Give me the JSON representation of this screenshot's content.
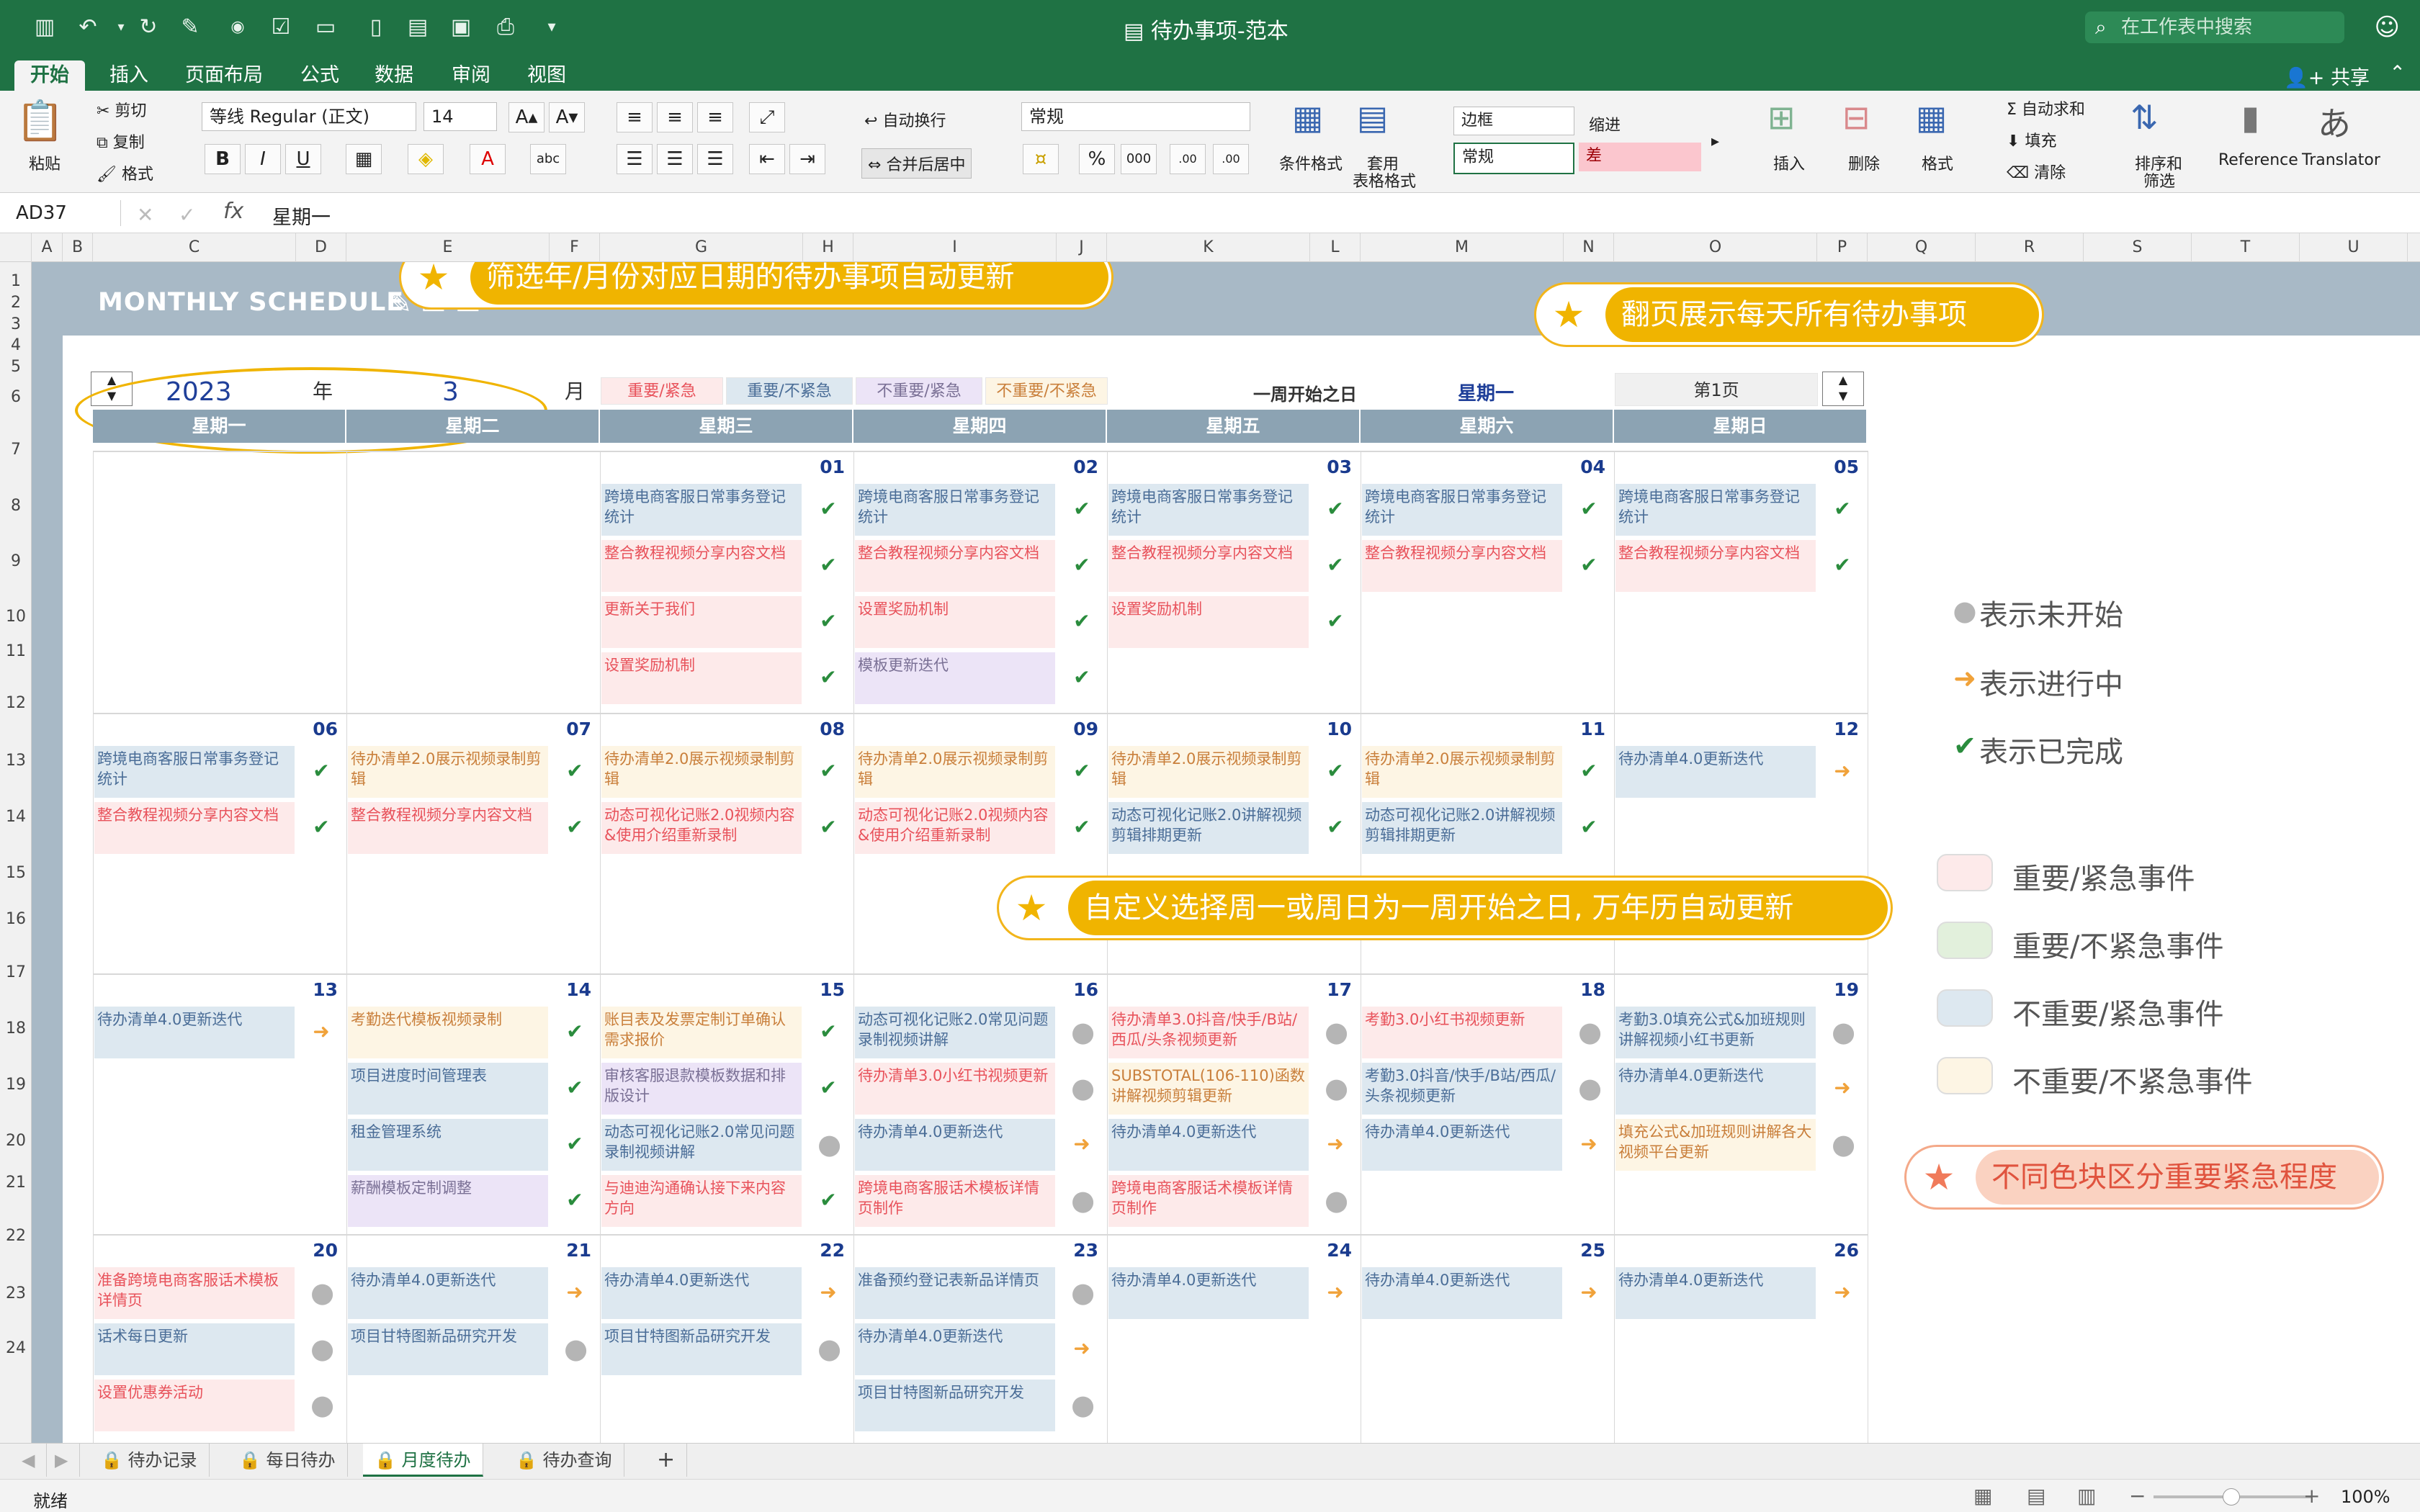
{
  "window": {
    "title": "待办事项-范本",
    "search_placeholder": "在工作表中搜索",
    "emoji": "☺"
  },
  "ribbon_tabs": [
    "开始",
    "插入",
    "页面布局",
    "公式",
    "数据",
    "审阅",
    "视图"
  ],
  "share_label": "共享",
  "ribbon": {
    "paste": "粘贴",
    "cut": "剪切",
    "copy": "复制",
    "format_painter": "格式",
    "font": "等线 Regular (正文)",
    "font_size": "14",
    "bold": "B",
    "italic": "I",
    "underline": "U",
    "wrap": "自动换行",
    "merge": "合并后居中",
    "number_format": "常规",
    "percent": "%",
    "thousands": "000",
    "dec_inc": ".00",
    "cond_format": "条件格式",
    "table_format_1": "套用",
    "table_format_2": "表格格式",
    "style_border": "边框",
    "style_indent": "缩进",
    "style_normal": "常规",
    "style_bad": "差",
    "insert": "插入",
    "delete": "删除",
    "format": "格式",
    "autosum": "自动求和",
    "fill": "填充",
    "clear": "清除",
    "sort_1": "排序和",
    "sort_2": "筛选",
    "reference": "Reference",
    "translator": "Translator"
  },
  "formula_bar": {
    "cell": "AD37",
    "fx": "fx",
    "content": "星期一"
  },
  "columns": [
    "A",
    "B",
    "C",
    "D",
    "E",
    "F",
    "G",
    "H",
    "I",
    "J",
    "K",
    "L",
    "M",
    "N",
    "O",
    "P",
    "Q",
    "R",
    "S",
    "T",
    "U"
  ],
  "rows": [
    "1",
    "2",
    "3",
    "4",
    "5",
    "6",
    "7",
    "8",
    "9",
    "10",
    "11",
    "12",
    "13",
    "14",
    "15",
    "16",
    "17",
    "18",
    "19",
    "20",
    "21",
    "22",
    "23",
    "24"
  ],
  "schedule": {
    "title": "MONTHLY SCHEDULE",
    "year": "2023",
    "year_label": "年",
    "month": "3",
    "month_label": "月",
    "tags": [
      "重要/紧急",
      "重要/不紧急",
      "不重要/紧急",
      "不重要/不紧急"
    ],
    "week_start_label": "一周开始之日",
    "week_start_value": "星期一",
    "page": "第1页",
    "weekdays": [
      "星期一",
      "星期二",
      "星期三",
      "星期四",
      "星期五",
      "星期六",
      "星期日"
    ]
  },
  "weeks": [
    {
      "days": [
        {
          "num": "",
          "tasks": []
        },
        {
          "num": "",
          "tasks": []
        },
        {
          "num": "01",
          "tasks": [
            {
              "t": "跨境电商客服日常事务登记统计",
              "c": "b",
              "s": "chk"
            },
            {
              "t": "整合教程视频分享内容文档",
              "c": "p",
              "s": "chk"
            },
            {
              "t": "更新关于我们",
              "c": "p",
              "s": "chk"
            },
            {
              "t": "设置奖励机制",
              "c": "p",
              "s": "chk"
            }
          ]
        },
        {
          "num": "02",
          "tasks": [
            {
              "t": "跨境电商客服日常事务登记统计",
              "c": "b",
              "s": "chk"
            },
            {
              "t": "整合教程视频分享内容文档",
              "c": "p",
              "s": "chk"
            },
            {
              "t": "设置奖励机制",
              "c": "p",
              "s": "chk"
            },
            {
              "t": "模板更新迭代",
              "c": "v",
              "s": "chk"
            }
          ]
        },
        {
          "num": "03",
          "tasks": [
            {
              "t": "跨境电商客服日常事务登记统计",
              "c": "b",
              "s": "chk"
            },
            {
              "t": "整合教程视频分享内容文档",
              "c": "p",
              "s": "chk"
            },
            {
              "t": "设置奖励机制",
              "c": "p",
              "s": "chk"
            }
          ]
        },
        {
          "num": "04",
          "tasks": [
            {
              "t": "跨境电商客服日常事务登记统计",
              "c": "b",
              "s": "chk"
            },
            {
              "t": "整合教程视频分享内容文档",
              "c": "p",
              "s": "chk"
            }
          ]
        },
        {
          "num": "05",
          "tasks": [
            {
              "t": "跨境电商客服日常事务登记统计",
              "c": "b",
              "s": "chk"
            },
            {
              "t": "整合教程视频分享内容文档",
              "c": "p",
              "s": "chk"
            }
          ]
        }
      ]
    },
    {
      "days": [
        {
          "num": "06",
          "tasks": [
            {
              "t": "跨境电商客服日常事务登记统计",
              "c": "b",
              "s": "chk"
            },
            {
              "t": "整合教程视频分享内容文档",
              "c": "p",
              "s": "chk"
            }
          ]
        },
        {
          "num": "07",
          "tasks": [
            {
              "t": "待办清单2.0展示视频录制剪辑",
              "c": "y",
              "s": "chk"
            },
            {
              "t": "整合教程视频分享内容文档",
              "c": "p",
              "s": "chk"
            }
          ]
        },
        {
          "num": "08",
          "tasks": [
            {
              "t": "待办清单2.0展示视频录制剪辑",
              "c": "y",
              "s": "chk"
            },
            {
              "t": "动态可视化记账2.0视频内容&使用介绍重新录制",
              "c": "p",
              "s": "chk"
            }
          ]
        },
        {
          "num": "09",
          "tasks": [
            {
              "t": "待办清单2.0展示视频录制剪辑",
              "c": "y",
              "s": "chk"
            },
            {
              "t": "动态可视化记账2.0视频内容&使用介绍重新录制",
              "c": "p",
              "s": "chk"
            }
          ]
        },
        {
          "num": "10",
          "tasks": [
            {
              "t": "待办清单2.0展示视频录制剪辑",
              "c": "y",
              "s": "chk"
            },
            {
              "t": "动态可视化记账2.0讲解视频剪辑排期更新",
              "c": "b",
              "s": "chk"
            }
          ]
        },
        {
          "num": "11",
          "tasks": [
            {
              "t": "待办清单2.0展示视频录制剪辑",
              "c": "y",
              "s": "chk"
            },
            {
              "t": "动态可视化记账2.0讲解视频剪辑排期更新",
              "c": "b",
              "s": "chk"
            }
          ]
        },
        {
          "num": "12",
          "tasks": [
            {
              "t": "待办清单4.0更新迭代",
              "c": "b",
              "s": "arr"
            }
          ]
        }
      ]
    },
    {
      "days": [
        {
          "num": "13",
          "tasks": [
            {
              "t": "待办清单4.0更新迭代",
              "c": "b",
              "s": "arr"
            }
          ]
        },
        {
          "num": "14",
          "tasks": [
            {
              "t": "考勤迭代模板视频录制",
              "c": "y",
              "s": "chk"
            },
            {
              "t": "项目进度时间管理表",
              "c": "b",
              "s": "chk"
            },
            {
              "t": "租金管理系统",
              "c": "b",
              "s": "chk"
            },
            {
              "t": "薪酬模板定制调整",
              "c": "v",
              "s": "chk"
            }
          ]
        },
        {
          "num": "15",
          "tasks": [
            {
              "t": "账目表及发票定制订单确认需求报价",
              "c": "y",
              "s": "chk"
            },
            {
              "t": "审核客服退款模板数据和排版设计",
              "c": "v",
              "s": "chk"
            },
            {
              "t": "动态可视化记账2.0常见问题录制视频讲解",
              "c": "b",
              "s": "dot"
            },
            {
              "t": "与迪迪沟通确认接下来内容方向",
              "c": "p",
              "s": "chk"
            }
          ]
        },
        {
          "num": "16",
          "tasks": [
            {
              "t": "动态可视化记账2.0常见问题录制视频讲解",
              "c": "b",
              "s": "dot"
            },
            {
              "t": "待办清单3.0小红书视频更新",
              "c": "p",
              "s": "dot"
            },
            {
              "t": "待办清单4.0更新迭代",
              "c": "b",
              "s": "arr"
            },
            {
              "t": "跨境电商客服话术模板详情页制作",
              "c": "p",
              "s": "dot"
            }
          ]
        },
        {
          "num": "17",
          "tasks": [
            {
              "t": "待办清单3.0抖音/快手/B站/西瓜/头条视频更新",
              "c": "p",
              "s": "dot"
            },
            {
              "t": "SUBSTOTAL(106-110)函数讲解视频剪辑更新",
              "c": "y",
              "s": "dot"
            },
            {
              "t": "待办清单4.0更新迭代",
              "c": "b",
              "s": "arr"
            },
            {
              "t": "跨境电商客服话术模板详情页制作",
              "c": "p",
              "s": "dot"
            }
          ]
        },
        {
          "num": "18",
          "tasks": [
            {
              "t": "考勤3.0小红书视频更新",
              "c": "p",
              "s": "dot"
            },
            {
              "t": "考勤3.0抖音/快手/B站/西瓜/头条视频更新",
              "c": "b",
              "s": "dot"
            },
            {
              "t": "待办清单4.0更新迭代",
              "c": "b",
              "s": "arr"
            }
          ]
        },
        {
          "num": "19",
          "tasks": [
            {
              "t": "考勤3.0填充公式&加班规则讲解视频小红书更新",
              "c": "b",
              "s": "dot"
            },
            {
              "t": "待办清单4.0更新迭代",
              "c": "b",
              "s": "arr"
            },
            {
              "t": "填充公式&加班规则讲解各大视频平台更新",
              "c": "y",
              "s": "dot"
            }
          ]
        }
      ]
    },
    {
      "days": [
        {
          "num": "20",
          "tasks": [
            {
              "t": "准备跨境电商客服话术模板详情页",
              "c": "p",
              "s": "dot"
            },
            {
              "t": "话术每日更新",
              "c": "b",
              "s": "dot"
            },
            {
              "t": "设置优惠券活动",
              "c": "p",
              "s": "dot"
            }
          ]
        },
        {
          "num": "21",
          "tasks": [
            {
              "t": "待办清单4.0更新迭代",
              "c": "b",
              "s": "arr"
            },
            {
              "t": "项目甘特图新品研究开发",
              "c": "b",
              "s": "dot"
            }
          ]
        },
        {
          "num": "22",
          "tasks": [
            {
              "t": "待办清单4.0更新迭代",
              "c": "b",
              "s": "arr"
            },
            {
              "t": "项目甘特图新品研究开发",
              "c": "b",
              "s": "dot"
            }
          ]
        },
        {
          "num": "23",
          "tasks": [
            {
              "t": "准备预约登记表新品详情页",
              "c": "b",
              "s": "dot"
            },
            {
              "t": "待办清单4.0更新迭代",
              "c": "b",
              "s": "arr"
            },
            {
              "t": "项目甘特图新品研究开发",
              "c": "b",
              "s": "dot"
            }
          ]
        },
        {
          "num": "24",
          "tasks": [
            {
              "t": "待办清单4.0更新迭代",
              "c": "b",
              "s": "arr"
            }
          ]
        },
        {
          "num": "25",
          "tasks": [
            {
              "t": "待办清单4.0更新迭代",
              "c": "b",
              "s": "arr"
            }
          ]
        },
        {
          "num": "26",
          "tasks": [
            {
              "t": "待办清单4.0更新迭代",
              "c": "b",
              "s": "arr"
            }
          ]
        }
      ]
    }
  ],
  "status_legend": [
    {
      "icon": "dot",
      "label": "表示未开始"
    },
    {
      "icon": "arrow",
      "label": "表示进行中"
    },
    {
      "icon": "check",
      "label": "表示已完成"
    }
  ],
  "color_legend": [
    {
      "color": "#fdeaea",
      "label": "重要/紧急事件"
    },
    {
      "color": "#e2f0dc",
      "label": "重要/不紧急事件"
    },
    {
      "color": "#dde8f0",
      "label": "不重要/紧急事件"
    },
    {
      "color": "#fdf5e4",
      "label": "不重要/不紧急事件"
    }
  ],
  "callouts": {
    "filter": "筛选年/月份对应日期的待办事项自动更新",
    "paging": "翻页展示每天所有待办事项",
    "weekstart": "自定义选择周一或周日为一周开始之日, 万年历自动更新",
    "colors": "不同色块区分重要紧急程度"
  },
  "sheet_tabs": [
    "待办记录",
    "每日待办",
    "月度待办",
    "待办查询"
  ],
  "active_tab": "月度待办",
  "status": {
    "ready": "就绪",
    "zoom": "100%"
  },
  "colors": {
    "green": "#1f7244",
    "slate": "#8ca3b3",
    "accent": "#f0b400"
  }
}
